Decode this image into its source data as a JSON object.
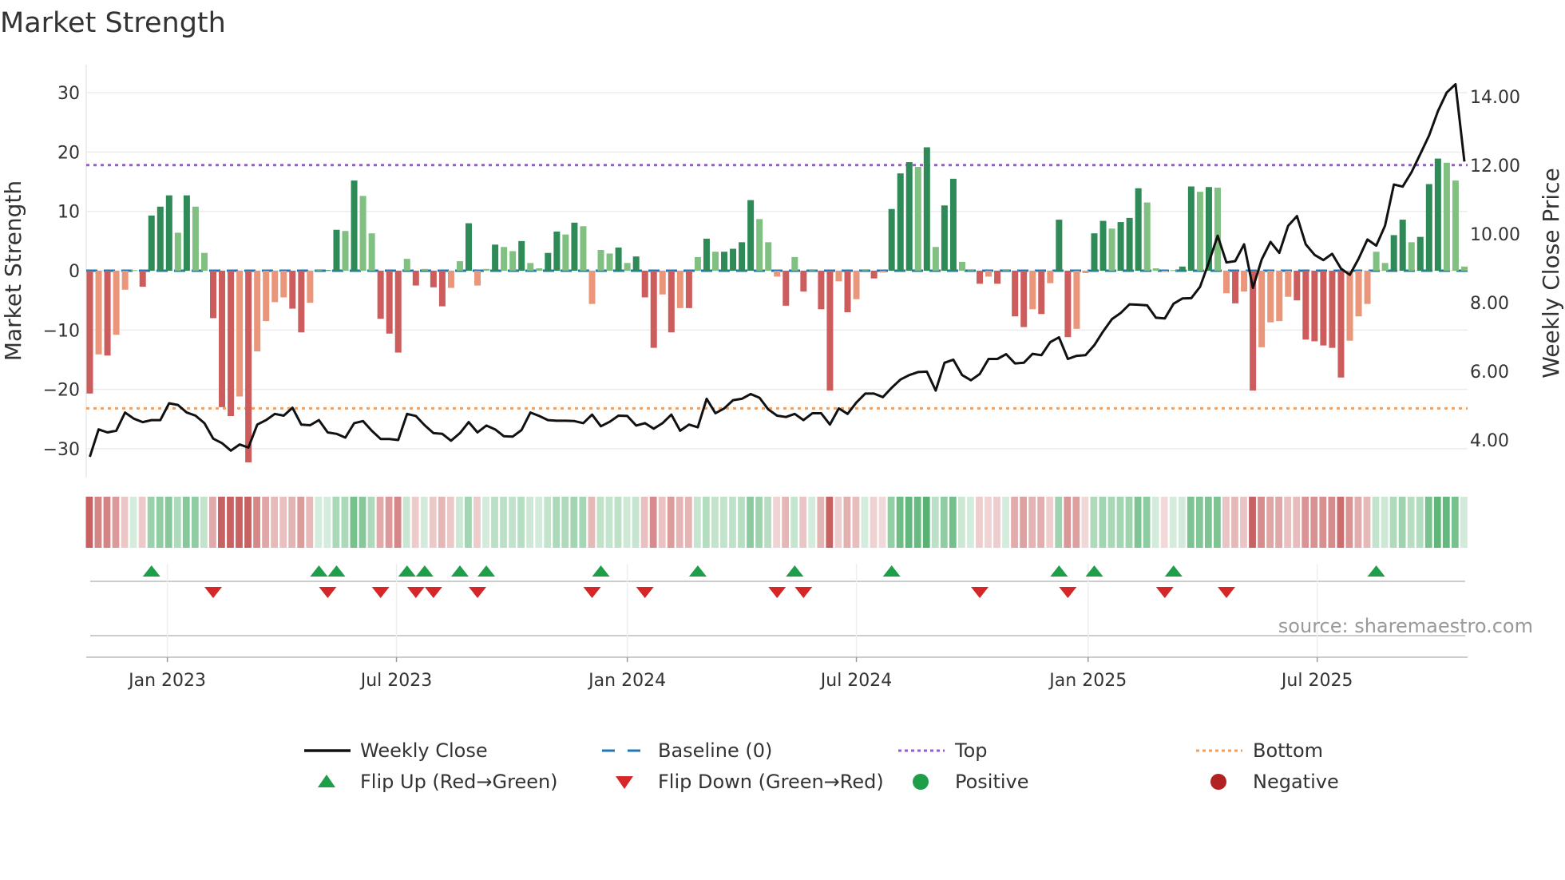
{
  "title": "Market Strength",
  "source": "source: sharemaestro.com",
  "chart_data": {
    "type": "bar",
    "title": "Market Strength",
    "ylabel": "Market Strength",
    "y2label": "Weekly Close Price",
    "ylim": [
      -34,
      35
    ],
    "y2lim": [
      3.1,
      15.1
    ],
    "yticks": [
      30,
      20,
      10,
      0,
      -10,
      -20,
      -30
    ],
    "ytick_labels": [
      "30",
      "20",
      "10",
      "0",
      "−10",
      "−20",
      "−30"
    ],
    "y2ticks": [
      14,
      12,
      10,
      8,
      6,
      4
    ],
    "y2tick_labels": [
      "14.00",
      "12.00",
      "10.00",
      "8.00",
      "6.00",
      "4.00"
    ],
    "xticks": [
      8.8,
      34.8,
      61,
      87,
      113.3,
      139.3
    ],
    "xtick_labels": [
      "Jan 2023",
      "Jul 2023",
      "Jan 2024",
      "Jul 2024",
      "Jan 2025",
      "Jul 2025"
    ],
    "top_level": 17.8,
    "bottom_level": -23.2,
    "baseline": 0,
    "strength": [
      -20.7,
      -14.1,
      -14.3,
      -10.8,
      -3.2,
      0.1,
      -2.7,
      9.3,
      10.8,
      12.7,
      6.4,
      12.7,
      10.8,
      3.0,
      -8.0,
      -23.0,
      -24.5,
      -21.2,
      -32.3,
      -13.6,
      -8.5,
      -5.3,
      -4.5,
      -6.4,
      -10.4,
      -5.4,
      0.1,
      0.1,
      6.9,
      6.7,
      15.2,
      12.6,
      6.3,
      -8.1,
      -10.6,
      -13.8,
      2.0,
      -2.5,
      0.3,
      -2.8,
      -6.0,
      -2.9,
      1.6,
      8.0,
      -2.5,
      0.3,
      4.4,
      4.0,
      3.3,
      5.0,
      1.3,
      0.4,
      3.0,
      6.6,
      6.1,
      8.1,
      7.5,
      -5.6,
      3.5,
      2.9,
      3.9,
      1.3,
      2.4,
      -4.5,
      -13.0,
      -4.0,
      -10.4,
      -6.3,
      -6.3,
      2.3,
      5.4,
      3.2,
      3.2,
      3.7,
      4.8,
      11.9,
      8.7,
      4.8,
      -1.0,
      -5.9,
      2.3,
      -3.5,
      0.1,
      -6.5,
      -20.2,
      -1.8,
      -7.0,
      -4.8,
      0.1,
      -1.3,
      -0.3,
      10.4,
      16.4,
      18.3,
      17.5,
      20.8,
      4.0,
      11.0,
      15.5,
      1.5,
      0.1,
      -2.2,
      -1.0,
      -2.2,
      0.1,
      -7.7,
      -9.5,
      -6.5,
      -7.3,
      -2.1,
      8.6,
      -11.2,
      -9.8,
      -0.4,
      6.3,
      8.4,
      7.1,
      8.2,
      8.9,
      13.9,
      11.5,
      0.4,
      -0.2,
      0.1,
      0.7,
      14.2,
      13.3,
      14.1,
      14.0,
      -3.8,
      -5.5,
      -3.5,
      -20.2,
      -12.9,
      -8.7,
      -8.5,
      -4.4,
      -5.0,
      -11.6,
      -11.9,
      -12.6,
      -13.0,
      -18.0,
      -11.8,
      -7.7,
      -5.6,
      3.2,
      1.3,
      6.0,
      8.6,
      4.8,
      5.7,
      14.6,
      18.9,
      18.2,
      15.2,
      0.7
    ],
    "weekly_close": [
      3.51,
      4.31,
      4.22,
      4.27,
      4.8,
      4.62,
      4.52,
      4.58,
      4.58,
      5.07,
      5.02,
      4.8,
      4.71,
      4.49,
      4.04,
      3.91,
      3.69,
      3.87,
      3.78,
      4.45,
      4.58,
      4.76,
      4.71,
      4.94,
      4.45,
      4.43,
      4.58,
      4.22,
      4.18,
      4.07,
      4.49,
      4.55,
      4.27,
      4.03,
      4.03,
      4.0,
      4.76,
      4.7,
      4.43,
      4.2,
      4.18,
      3.98,
      4.2,
      4.52,
      4.22,
      4.42,
      4.31,
      4.11,
      4.1,
      4.29,
      4.8,
      4.7,
      4.58,
      4.56,
      4.56,
      4.55,
      4.49,
      4.74,
      4.4,
      4.53,
      4.71,
      4.7,
      4.42,
      4.49,
      4.33,
      4.49,
      4.74,
      4.27,
      4.45,
      4.37,
      5.2,
      4.78,
      4.92,
      5.16,
      5.2,
      5.34,
      5.23,
      4.89,
      4.71,
      4.67,
      4.76,
      4.58,
      4.78,
      4.78,
      4.45,
      4.92,
      4.76,
      5.09,
      5.35,
      5.35,
      5.25,
      5.52,
      5.76,
      5.89,
      5.98,
      5.99,
      5.44,
      6.25,
      6.34,
      5.89,
      5.74,
      5.92,
      6.36,
      6.36,
      6.5,
      6.23,
      6.25,
      6.51,
      6.47,
      6.85,
      6.99,
      6.36,
      6.45,
      6.47,
      6.76,
      7.16,
      7.52,
      7.7,
      7.95,
      7.94,
      7.92,
      7.56,
      7.54,
      7.97,
      8.12,
      8.13,
      8.46,
      9.17,
      9.95,
      9.17,
      9.21,
      9.7,
      8.43,
      9.26,
      9.77,
      9.45,
      10.24,
      10.52,
      9.7,
      9.39,
      9.24,
      9.42,
      8.99,
      8.81,
      9.28,
      9.84,
      9.66,
      10.24,
      11.44,
      11.38,
      11.8,
      12.33,
      12.87,
      13.58,
      14.12,
      14.36,
      12.11
    ],
    "flip_up_weeks": [
      7,
      26,
      28,
      36,
      38,
      42,
      45,
      58,
      69,
      80,
      91,
      110,
      114,
      123,
      146
    ],
    "flip_down_weeks": [
      14,
      27,
      33,
      37,
      39,
      44,
      57,
      63,
      78,
      81,
      101,
      111,
      122,
      129
    ],
    "legend": [
      {
        "label": "Weekly Close",
        "kind": "line",
        "color": "#111111"
      },
      {
        "label": "Baseline (0)",
        "kind": "dash",
        "color": "#1f77b4"
      },
      {
        "label": "Top",
        "kind": "dot",
        "color": "#9b59d0"
      },
      {
        "label": "Bottom",
        "kind": "dot",
        "color": "#f0a060"
      },
      {
        "label": "Flip Up (Red→Green)",
        "kind": "tri-up",
        "color": "#1f9e4a"
      },
      {
        "label": "Flip Down (Green→Red)",
        "kind": "tri-down",
        "color": "#d62728"
      },
      {
        "label": "Positive",
        "kind": "dot-marker",
        "color": "#1f9e4a"
      },
      {
        "label": "Negative",
        "kind": "dot-marker",
        "color": "#b22222"
      }
    ],
    "legend_position": "bottom",
    "colors": {
      "pos_strong": "#2e8b57",
      "pos_weak": "#80c080",
      "neg_strong": "#cd5c5c",
      "neg_weak": "#e9967a",
      "grid": "#ececec"
    }
  }
}
